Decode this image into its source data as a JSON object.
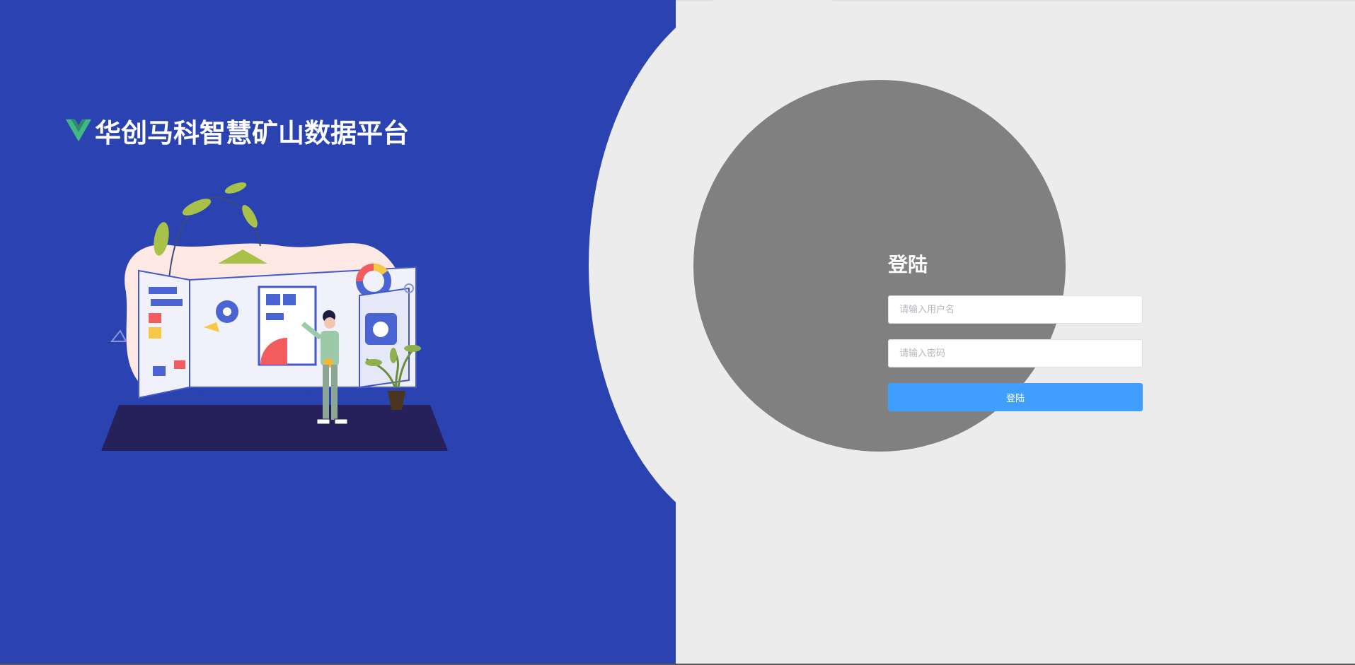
{
  "app": {
    "title": "华创马科智慧矿山数据平台"
  },
  "login": {
    "heading": "登陆",
    "username_placeholder": "请输入用户名",
    "username_value": "",
    "password_placeholder": "请输入密码",
    "password_value": "",
    "submit_label": "登陆"
  },
  "icons": {
    "logo": "vue-logo-icon",
    "illustration": "dashboard-presenter-illustration"
  },
  "colors": {
    "left_panel": "#2a43b1",
    "right_panel": "#ececec",
    "circle": "#808080",
    "button": "#409eff",
    "logo_outer": "#41b883",
    "logo_inner": "#35495e"
  }
}
